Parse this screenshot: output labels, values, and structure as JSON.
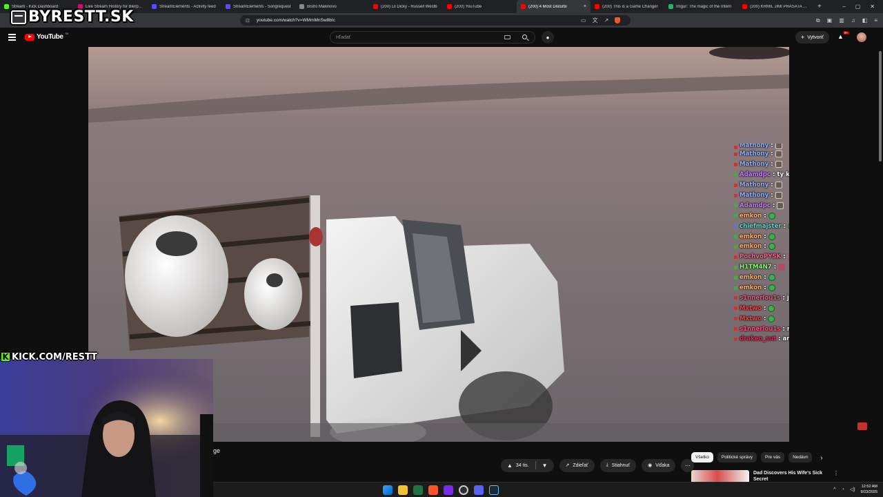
{
  "browser": {
    "tabs": [
      {
        "title": "Stream - Kick Dashboard",
        "color": "#53fc18",
        "active": false
      },
      {
        "title": "Live Stream History for Blerp Str",
        "color": "#e5007a",
        "active": false
      },
      {
        "title": "StreamElements - Activity feed",
        "color": "#5b4bff",
        "active": false
      },
      {
        "title": "StreamElements - Songrequest",
        "color": "#5b4bff",
        "active": false
      },
      {
        "title": "Bistro Makinovo",
        "color": "#888888",
        "active": false
      },
      {
        "title": "(200) Lil Dicky - Russell Westb",
        "color": "#ff0000",
        "active": false
      },
      {
        "title": "(200) YouTube",
        "color": "#ff0000",
        "active": false
      },
      {
        "title": "(200) 4 Most Disturbi",
        "color": "#ff0000",
        "active": true
      },
      {
        "title": "(200) This is a Game Changer",
        "color": "#ff0000",
        "active": false
      },
      {
        "title": "Imgur: The magic of the Intern",
        "color": "#1bb76e",
        "active": false
      },
      {
        "title": "(200) KRMIL JIMI PRASATA | ka",
        "color": "#ff0000",
        "active": false
      }
    ],
    "url": "youtube.com/watch?v=WMmMnSw8bIc"
  },
  "watermark": {
    "top": "BYRESTT.SK",
    "kick": "KICK.COM/RESTT"
  },
  "youtube": {
    "logo": "YouTube",
    "region": "SK",
    "search_placeholder": "Hľadať",
    "create_label": "Vytvoriť",
    "notif_badge": "9+",
    "title_fragment": "ge",
    "like_count": "34 tis.",
    "share_label": "Zdieľať",
    "download_label": "Stiahnuť",
    "thanks_label": "Vďaka",
    "chips": [
      "Všetko",
      "Politické správy",
      "Pre vás",
      "Nedávn"
    ],
    "rec_title": "Dad Discovers His Wife's Sick Secret"
  },
  "chat": [
    {
      "user": "Mathony",
      "color": "#8fb3ff",
      "badge": "#cc3333",
      "msg": "",
      "emote": "face"
    },
    {
      "user": "Mathony",
      "color": "#8fb3ff",
      "badge": "#cc3333",
      "msg": "",
      "emote": "face"
    },
    {
      "user": "Mathony",
      "color": "#8fb3ff",
      "badge": "#cc3333",
      "msg": "",
      "emote": "face"
    },
    {
      "user": "Adamdpc",
      "color": "#c77bff",
      "badge": "#44aa44",
      "msg": "ty kokot",
      "emote": ""
    },
    {
      "user": "Mathony",
      "color": "#8fb3ff",
      "badge": "#cc3333",
      "msg": "",
      "emote": "face"
    },
    {
      "user": "Mathony",
      "color": "#8fb3ff",
      "badge": "#cc3333",
      "msg": "",
      "emote": "face"
    },
    {
      "user": "Adamdpc",
      "color": "#c77bff",
      "badge": "#44aa44",
      "msg": "",
      "emote": "face"
    },
    {
      "user": "emkon",
      "color": "#ffb36b",
      "badge": "#44aa44",
      "msg": "",
      "emote": "green"
    },
    {
      "user": "chiefmajster",
      "color": "#3ee6d6",
      "badge": "#4a80d0",
      "msg": "",
      "emote": "green"
    },
    {
      "user": "emkon",
      "color": "#ffb36b",
      "badge": "#44aa44",
      "msg": "",
      "emote": "green"
    },
    {
      "user": "emkon",
      "color": "#ffb36b",
      "badge": "#44aa44",
      "msg": "",
      "emote": "green"
    },
    {
      "user": "PochvoPYSK",
      "color": "#ff5d8f",
      "badge": "#cc3333",
      "msg": "",
      "emote": "pink"
    },
    {
      "user": "H1TM4N7",
      "color": "#7dff6b",
      "badge": "#44aa44",
      "msg": "",
      "emote": "pink"
    },
    {
      "user": "emkon",
      "color": "#ffb36b",
      "badge": "#44aa44",
      "msg": "",
      "emote": "green"
    },
    {
      "user": "emkon",
      "color": "#ffb36b",
      "badge": "#44aa44",
      "msg": "",
      "emote": "green"
    },
    {
      "user": "s1nnerlou1s",
      "color": "#ff4d7a",
      "badge": "#cc3333",
      "msg": "ja",
      "emote": ""
    },
    {
      "user": "Mxtwo",
      "color": "#ff3b3b",
      "badge": "#cc3333",
      "msg": "",
      "emote": "green"
    },
    {
      "user": "Mxtwo",
      "color": "#ff3b3b",
      "badge": "#cc3333",
      "msg": "",
      "emote": "green"
    },
    {
      "user": "s1nnerlou1s",
      "color": "#ff4d7a",
      "badge": "#cc3333",
      "msg": "mi jebalo",
      "emote": ""
    },
    {
      "user": "drakeo_sut",
      "color": "#d92b5a",
      "badge": "#cc3333",
      "msg": "anlaky",
      "emote": ""
    }
  ],
  "taskbar": {
    "time": "12:52 AM",
    "date": "9/23/2025"
  },
  "icons": {
    "tab_close": "×",
    "new_tab": "+",
    "minimize": "–",
    "maximize": "▢",
    "close": "✕",
    "bookmark": "⊡",
    "like": "👍",
    "dislike": "👎",
    "share": "↗",
    "download": "⤓",
    "thanks": "❤",
    "more": "⋯",
    "next": "›",
    "plus": "+",
    "bell": "🔔",
    "mic": "🎤",
    "rec_more": "⋮"
  }
}
